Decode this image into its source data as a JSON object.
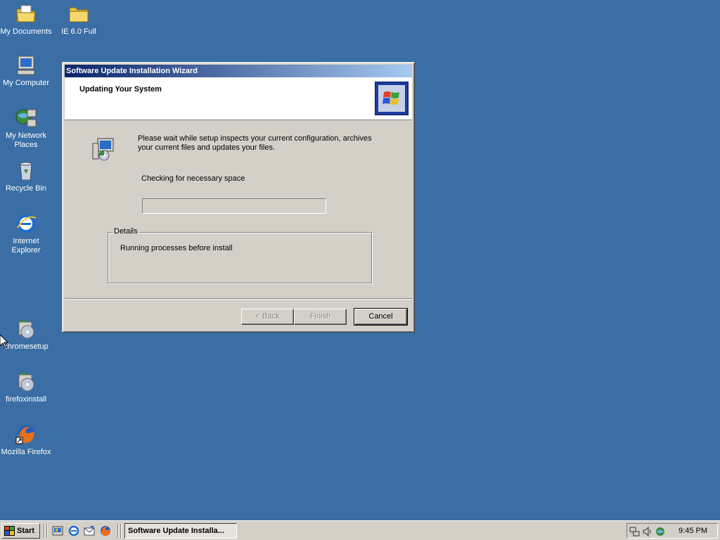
{
  "desktop": {
    "icons": [
      {
        "label": "My Documents",
        "icon": "my-documents-icon"
      },
      {
        "label": "IE 6.0 Full",
        "icon": "folder-icon"
      },
      {
        "label": "My Computer",
        "icon": "my-computer-icon"
      },
      {
        "label": "My Network Places",
        "icon": "network-places-icon"
      },
      {
        "label": "Recycle Bin",
        "icon": "recycle-bin-icon"
      },
      {
        "label": "Internet Explorer",
        "icon": "internet-explorer-icon"
      },
      {
        "label": "chromesetup",
        "icon": "installer-icon"
      },
      {
        "label": "firefoxinstall",
        "icon": "installer-icon"
      },
      {
        "label": "Mozilla Firefox",
        "icon": "firefox-icon"
      }
    ]
  },
  "wizard": {
    "title": "Software Update Installation Wizard",
    "header_title": "Updating Your System",
    "message": "Please wait while setup inspects your current configuration, archives your current files and updates your files.",
    "status": "Checking for necessary space",
    "progress_percent": 0,
    "details_legend": "Details",
    "details_text": "Running processes before install",
    "buttons": {
      "back": "< Back",
      "finish": "Finish",
      "cancel": "Cancel"
    }
  },
  "taskbar": {
    "start_label": "Start",
    "quick_launch": [
      "show-desktop-icon",
      "internet-explorer-icon",
      "outlook-express-icon",
      "firefox-icon"
    ],
    "task_label": "Software Update Installa...",
    "clock": "9:45 PM"
  },
  "colors": {
    "desktop": "#3a6ea5",
    "titlebar_start": "#0a246a",
    "titlebar_end": "#a6caf0",
    "face": "#d4d0c8"
  }
}
